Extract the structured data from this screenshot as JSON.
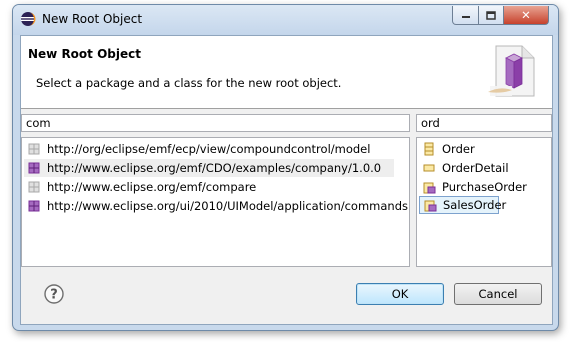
{
  "window": {
    "title": "New Root Object",
    "close_glyph": "✕"
  },
  "header": {
    "title": "New Root Object",
    "message": "Select a package and a class for the new root object."
  },
  "package_filter": {
    "value": "com"
  },
  "class_filter": {
    "value": "ord"
  },
  "packages": [
    {
      "label": "http://org/eclipse/emf/ecp/view/compoundcontrol/model",
      "icon": "package-gray-icon"
    },
    {
      "label": "http://www.eclipse.org/emf/CDO/examples/company/1.0.0",
      "icon": "package-purple-icon"
    },
    {
      "label": "http://www.eclipse.org/emf/compare",
      "icon": "package-gray-icon"
    },
    {
      "label": "http://www.eclipse.org/ui/2010/UIModel/application/commands",
      "icon": "package-purple-icon"
    }
  ],
  "classes": [
    {
      "label": "Order",
      "icon": "eclass-icon"
    },
    {
      "label": "OrderDetail",
      "icon": "eclass-icon"
    },
    {
      "label": "PurchaseOrder",
      "icon": "eclass-purple-icon"
    },
    {
      "label": "SalesOrder",
      "icon": "eclass-purple-icon"
    }
  ],
  "buttons": {
    "ok": "OK",
    "cancel": "Cancel",
    "help": "?"
  },
  "colors": {
    "accent": "#7da2ce",
    "package_purple": "#8b3fa8",
    "class_yellow": "#e8c75b"
  }
}
